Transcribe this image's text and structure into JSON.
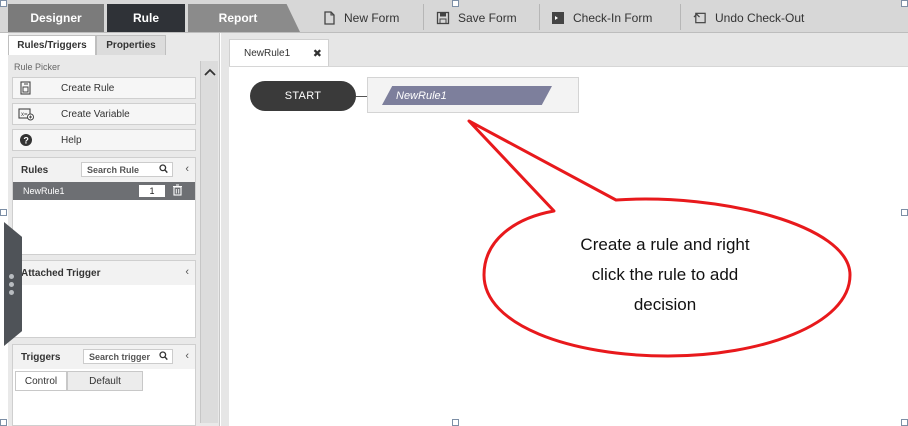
{
  "toolbar": {
    "tabs": [
      {
        "label": "Designer"
      },
      {
        "label": "Rule"
      },
      {
        "label": "Report"
      }
    ],
    "buttons": [
      {
        "label": "New Form",
        "icon": "new-form-icon"
      },
      {
        "label": "Save Form",
        "icon": "save-icon"
      },
      {
        "label": "Check-In Form",
        "icon": "check-in-icon"
      },
      {
        "label": "Undo Check-Out",
        "icon": "undo-icon"
      }
    ]
  },
  "left_panel": {
    "tabs": [
      {
        "label": "Rules/Triggers"
      },
      {
        "label": "Properties"
      }
    ],
    "picker_label": "Rule Picker",
    "picker_items": [
      {
        "label": "Create Rule",
        "icon": "create-rule-icon"
      },
      {
        "label": "Create Variable",
        "icon": "create-variable-icon"
      },
      {
        "label": "Help",
        "icon": "help-icon"
      }
    ],
    "rules": {
      "title": "Rules",
      "search_placeholder": "Search Rule",
      "items": [
        {
          "name": "NewRule1",
          "count": "1"
        }
      ]
    },
    "attached_trigger": {
      "title": "Attached Trigger"
    },
    "triggers": {
      "title": "Triggers",
      "search_placeholder": "Search trigger",
      "tabs": [
        {
          "label": "Control"
        },
        {
          "label": "Default"
        }
      ]
    }
  },
  "canvas": {
    "doc_tab": "NewRule1",
    "start_label": "START",
    "rule_label": "NewRule1"
  },
  "callout": {
    "lines": [
      "Create a rule and right",
      "click the rule to add",
      "decision"
    ],
    "border_color": "#e8191c"
  },
  "colors": {
    "active_tab": "#2f3237",
    "rule_selected_row": "#6d6f73",
    "rule_node": "#7d7f9c"
  }
}
